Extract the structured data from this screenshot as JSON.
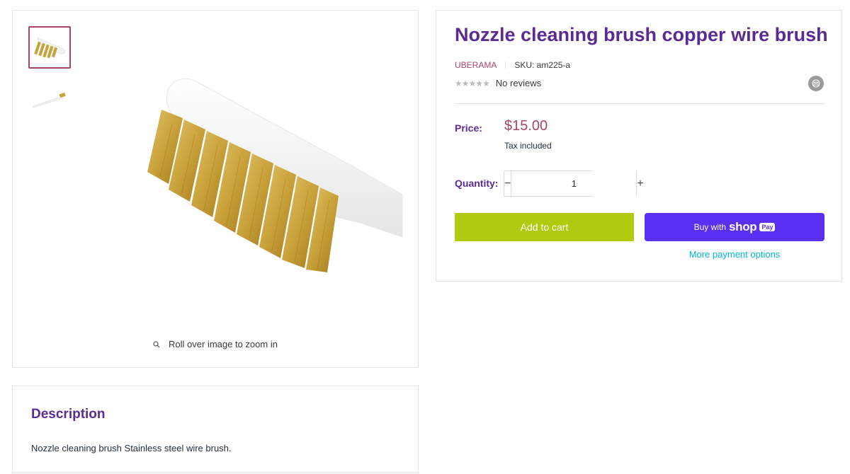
{
  "product": {
    "title": "Nozzle cleaning brush copper wire brush",
    "vendor": "UBERAMA",
    "sku": "SKU: am225-a",
    "rating_text": "No reviews",
    "stars": "★★★★★",
    "share_icon": "mail-icon"
  },
  "pricing": {
    "label": "Price:",
    "price": "$15.00",
    "tax_note": "Tax included"
  },
  "quantity": {
    "label": "Quantity:",
    "value": "1",
    "decrement": "−",
    "increment": "+"
  },
  "actions": {
    "add_to_cart": "Add to cart",
    "buy_with": "Buy with",
    "shop_word": "shop",
    "pay_badge": "Pay",
    "more_payment_options": "More payment options"
  },
  "gallery": {
    "zoom_hint": "Roll over image to zoom in",
    "thumbnails": [
      "brush-closeup",
      "brush-full"
    ],
    "active_thumbnail": 0
  },
  "description": {
    "title": "Description",
    "text": "Nozzle cleaning brush Stainless steel wire brush."
  },
  "colors": {
    "accent_purple": "#5c2b91",
    "price_color": "#a8456b",
    "add_to_cart_green": "#b1c90e",
    "shop_pay_purple": "#5a31f4",
    "link_cyan": "#00b5d6"
  }
}
